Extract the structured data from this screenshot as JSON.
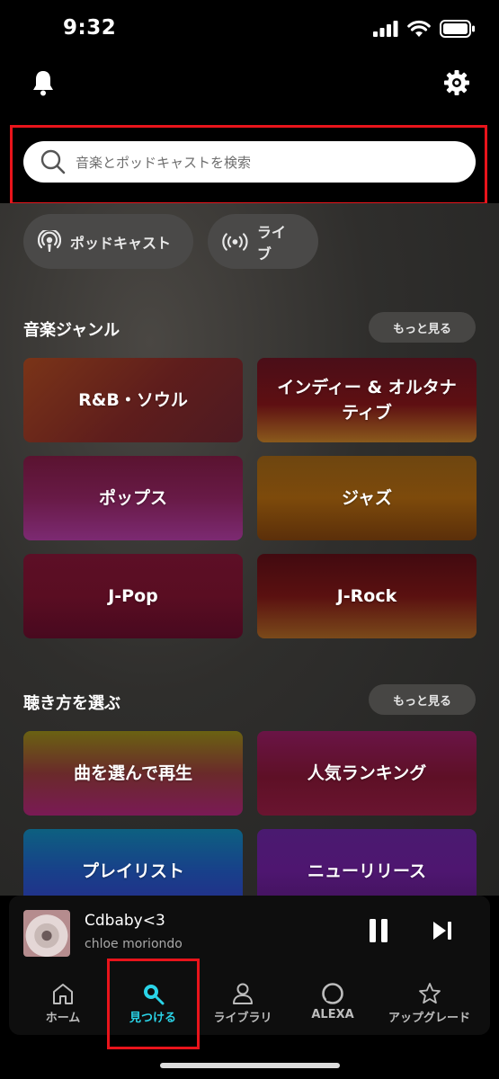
{
  "status": {
    "time": "9:32"
  },
  "search": {
    "placeholder": "音楽とポッドキャストを検索"
  },
  "chips": [
    {
      "label": "ポッドキャスト",
      "icon": "podcast-icon"
    },
    {
      "label": "ライブ",
      "icon": "live-icon"
    }
  ],
  "genres": {
    "title": "音楽ジャンル",
    "more": "もっと見る",
    "tiles": [
      {
        "label": "R&B・ソウル"
      },
      {
        "label": "インディー & オルタナティブ"
      },
      {
        "label": "ポップス"
      },
      {
        "label": "ジャズ"
      },
      {
        "label": "J-Pop"
      },
      {
        "label": "J-Rock"
      }
    ]
  },
  "listen": {
    "title": "聴き方を選ぶ",
    "more": "もっと見る",
    "tiles": [
      {
        "label": "曲を選んで再生"
      },
      {
        "label": "人気ランキング"
      },
      {
        "label": "プレイリスト"
      },
      {
        "label": "ニューリリース"
      }
    ]
  },
  "player": {
    "title": "Cdbaby<3",
    "artist": "chloe moriondo"
  },
  "nav": [
    {
      "label": "ホーム",
      "icon": "home-icon"
    },
    {
      "label": "見つける",
      "icon": "search-icon",
      "active": true
    },
    {
      "label": "ライブラリ",
      "icon": "person-icon"
    },
    {
      "label": "ALEXA",
      "icon": "alexa-icon"
    },
    {
      "label": "アップグレード",
      "icon": "star-icon"
    }
  ],
  "colors": {
    "accent": "#2ad4e8",
    "highlight": "#e8141b"
  }
}
